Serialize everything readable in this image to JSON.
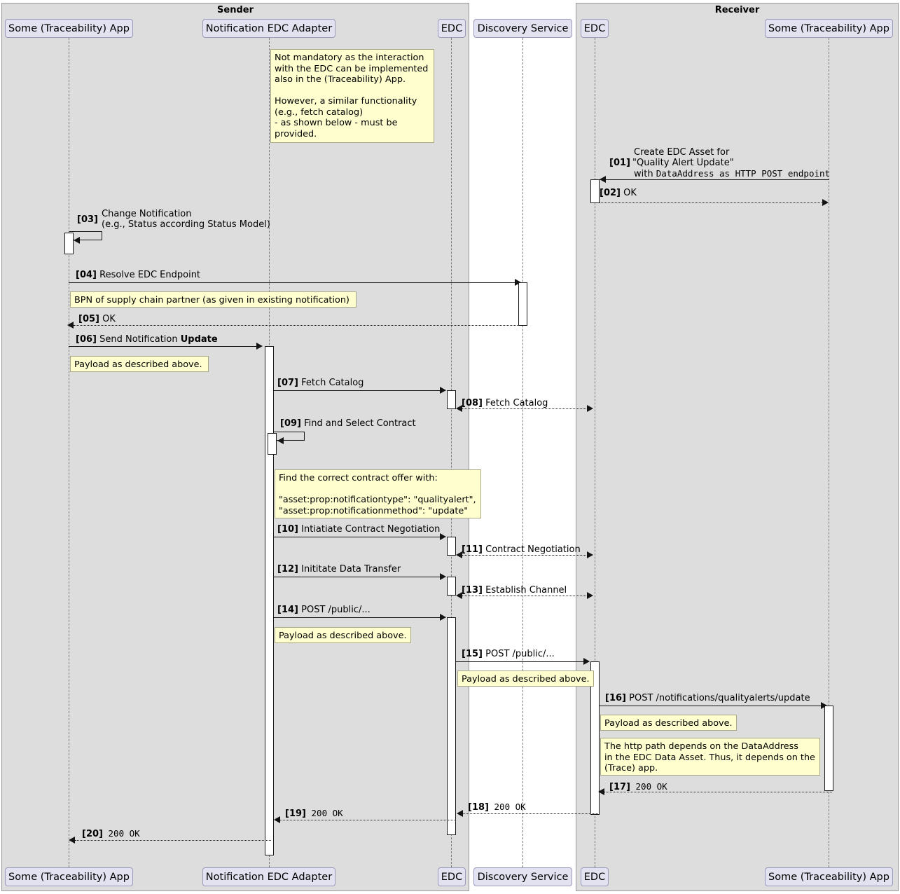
{
  "groups": [
    {
      "title": "Sender"
    },
    {
      "title": "Receiver"
    }
  ],
  "participants": [
    {
      "label": "Some (Traceability) App",
      "group": "Sender"
    },
    {
      "label": "Notification EDC Adapter",
      "group": "Sender"
    },
    {
      "label": "EDC",
      "group": "Sender"
    },
    {
      "label": "Discovery Service",
      "group": "none"
    },
    {
      "label": "EDC",
      "group": "Receiver"
    },
    {
      "label": "Some (Traceability) App",
      "group": "Receiver"
    }
  ],
  "messages": [
    {
      "num": "[01]",
      "text": "Create EDC Asset for\n\"Quality Alert Update\"\nwith DataAddress as HTTP  POST endpoint",
      "style": "solid",
      "dir": "left"
    },
    {
      "num": "[02]",
      "text": "OK",
      "style": "dotted",
      "dir": "right"
    },
    {
      "num": "[03]",
      "text": "Change Notification\n(e.g., Status according Status Model)",
      "style": "self",
      "dir": "self"
    },
    {
      "num": "[04]",
      "text": "Resolve EDC Endpoint",
      "style": "solid",
      "dir": "right"
    },
    {
      "num": "[05]",
      "text": "OK",
      "style": "dotted",
      "dir": "left"
    },
    {
      "num": "[06]",
      "text": "Send Notification ",
      "bold_suffix": "Update",
      "style": "solid",
      "dir": "right"
    },
    {
      "num": "[07]",
      "text": "Fetch Catalog",
      "style": "solid",
      "dir": "right"
    },
    {
      "num": "[08]",
      "text": "Fetch Catalog",
      "style": "dotted",
      "dir": "both"
    },
    {
      "num": "[09]",
      "text": "Find and Select Contract",
      "style": "self",
      "dir": "self"
    },
    {
      "num": "[10]",
      "text": "Intiatiate Contract Negotiation",
      "style": "solid",
      "dir": "right"
    },
    {
      "num": "[11]",
      "text": "Contract Negotiation",
      "style": "dotted",
      "dir": "both"
    },
    {
      "num": "[12]",
      "text": "Inititate Data Transfer",
      "style": "solid",
      "dir": "right"
    },
    {
      "num": "[13]",
      "text": "Establish Channel",
      "style": "dotted",
      "dir": "both"
    },
    {
      "num": "[14]",
      "text": "POST /public/...",
      "style": "solid",
      "dir": "right"
    },
    {
      "num": "[15]",
      "text": "POST /public/...",
      "style": "solid",
      "dir": "right"
    },
    {
      "num": "[16]",
      "text": "POST /notifications/qualityalerts/update",
      "style": "solid",
      "dir": "right"
    },
    {
      "num": "[17]",
      "text": "200 OK",
      "style": "dotted",
      "dir": "left",
      "mono": true
    },
    {
      "num": "[18]",
      "text": "200 OK",
      "style": "dotted",
      "dir": "left",
      "mono": true
    },
    {
      "num": "[19]",
      "text": "200 OK",
      "style": "dotted",
      "dir": "left",
      "mono": true
    },
    {
      "num": "[20]",
      "text": "200 OK",
      "style": "dotted",
      "dir": "left",
      "mono": true
    }
  ],
  "labels": {
    "m01_l1": "Create EDC Asset for",
    "m01_num": "[01]",
    "m01_l2": "\"Quality Alert Update\"",
    "m01_l3": "with DataAddress as HTTP  POST endpoint",
    "m02_num": "[02]",
    "m02_text": "OK",
    "m03_num": "[03]",
    "m03_l1": "Change Notification",
    "m03_l2": "(e.g., Status according Status Model)",
    "m04_num": "[04]",
    "m04_text": "Resolve EDC Endpoint",
    "m05_num": "[05]",
    "m05_text": "OK",
    "m06_num": "[06]",
    "m06_text": "Send Notification ",
    "m06_bold": "Update",
    "m07_num": "[07]",
    "m07_text": "Fetch Catalog",
    "m08_num": "[08]",
    "m08_text": "Fetch Catalog",
    "m09_num": "[09]",
    "m09_text": "Find and Select Contract",
    "m10_num": "[10]",
    "m10_text": "Intiatiate Contract Negotiation",
    "m11_num": "[11]",
    "m11_text": "Contract Negotiation",
    "m12_num": "[12]",
    "m12_text": "Inititate Data Transfer",
    "m13_num": "[13]",
    "m13_text": "Establish Channel",
    "m14_num": "[14]",
    "m14_text": "POST /public/...",
    "m15_num": "[15]",
    "m15_text": "POST /public/...",
    "m16_num": "[16]",
    "m16_text": "POST /notifications/qualityalerts/update",
    "m17_num": "[17]",
    "m17_text": "200 OK",
    "m18_num": "[18]",
    "m18_text": "200 OK",
    "m19_num": "[19]",
    "m19_text": "200 OK",
    "m20_num": "[20]",
    "m20_text": "200 OK"
  },
  "notes": [
    {
      "id": "note-adapter",
      "text": "Not mandatory as the interaction\nwith the EDC can be implemented\nalso in the (Traceability) App.\n\nHowever, a similar functionality\n(e.g., fetch catalog)\n- as shown below - must be\nprovided."
    },
    {
      "id": "note-bpn",
      "text": "BPN of supply chain partner (as given in existing notification)"
    },
    {
      "id": "note-payload-06",
      "text": "Payload as described above."
    },
    {
      "id": "note-contract",
      "text": "Find the correct contract offer with:\n\n\"asset:prop:notificationtype\": \"qualityalert\",\n\"asset:prop:notificationmethod\": \"update\""
    },
    {
      "id": "note-payload-14",
      "text": "Payload as described above."
    },
    {
      "id": "note-payload-15",
      "text": "Payload as described above."
    },
    {
      "id": "note-payload-16",
      "text": "Payload as described above."
    },
    {
      "id": "note-httppath",
      "text": "The http path depends on the DataAddress\nin the EDC Data Asset. Thus, it depends on the\n(Trace) app."
    }
  ],
  "participant_labels": {
    "p1_top": "Some (Traceability) App",
    "p2_top": "Notification EDC Adapter",
    "p3_top": "EDC",
    "p4_top": "Discovery Service",
    "p5_top": "EDC",
    "p6_top": "Some (Traceability) App",
    "p1_bot": "Some (Traceability) App",
    "p2_bot": "Notification EDC Adapter",
    "p3_bot": "EDC",
    "p4_bot": "Discovery Service",
    "p5_bot": "EDC",
    "p6_bot": "Some (Traceability) App"
  },
  "group_titles": {
    "sender": "Sender",
    "receiver": "Receiver"
  },
  "colors": {
    "group_bg": "#DDDDDD",
    "group_border": "#999999",
    "participant_bg": "#E2E2F0",
    "participant_border": "#9A9ABA",
    "note_bg": "#FEFECE",
    "note_border": "#A8A884",
    "line": "#141414",
    "lifeline": "#7A7A7A"
  }
}
